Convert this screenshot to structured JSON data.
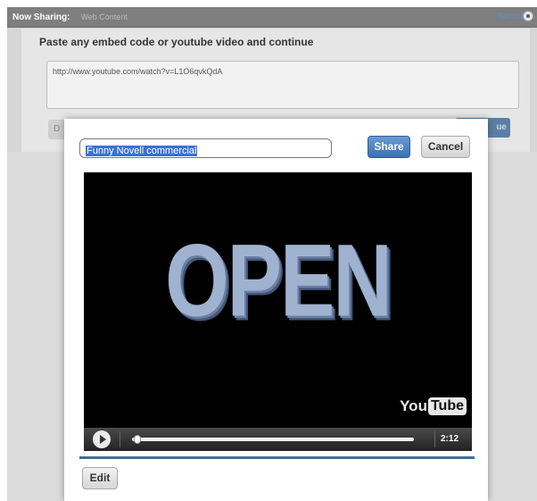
{
  "topbar": {
    "share_label": "Now Sharing:",
    "share_value": "Web Content",
    "record_label": "Record",
    "record_icon": "record-dot-icon"
  },
  "panel": {
    "title": "Paste any embed code or youtube video and continue",
    "embed_value": "http://www.youtube.com/watch?v=L1O6qvkQdA",
    "left_button_label": "D",
    "continue_label": "ue"
  },
  "modal": {
    "title_value": "Funny Novell commercial",
    "share_label": "Share",
    "cancel_label": "Cancel",
    "edit_label": "Edit"
  },
  "video": {
    "frame_text": "OPEN",
    "logo_you": "You",
    "logo_tube": "Tube",
    "time": "2:12",
    "progress": 0.02,
    "play_icon": "play-icon"
  },
  "colors": {
    "accent": "#3b6fb1",
    "rule": "#3f6e9c",
    "topbar": "#7e7e7e",
    "selection": "#3a71d8"
  }
}
